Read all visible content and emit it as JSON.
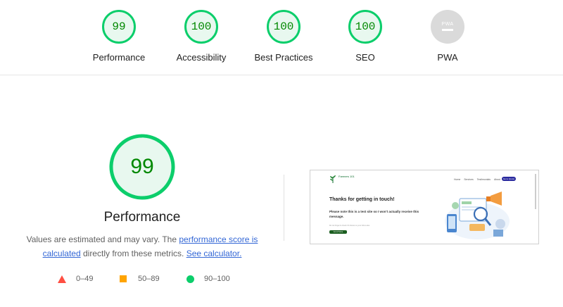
{
  "categories": [
    {
      "label": "Performance",
      "score": "99"
    },
    {
      "label": "Accessibility",
      "score": "100"
    },
    {
      "label": "Best Practices",
      "score": "100"
    },
    {
      "label": "SEO",
      "score": "100"
    },
    {
      "label": "PWA",
      "score": "PWA"
    }
  ],
  "main": {
    "score": "99",
    "score_fraction": 0.99,
    "title": "Performance",
    "desc_prefix": "Values are estimated and may vary. The ",
    "link_score": "performance score is calculated",
    "desc_mid": " directly from these metrics. ",
    "link_calc": "See calculator."
  },
  "legend": {
    "fail": "0–49",
    "average": "50–89",
    "pass": "90–100"
  },
  "thumbnail": {
    "brand": "Farmers 101",
    "nav": [
      "Home",
      "Services",
      "Testimonials",
      "About",
      "Contact"
    ],
    "cta": "Get a Quote",
    "heading": "Thanks for getting in touch!",
    "body": "Please note this is a test site so I won't actually receive this message.",
    "small": "Do not forget to check if it shows on your inbox also.",
    "button": "Go to Home"
  },
  "colors": {
    "pass": "#0cce6b",
    "pass_text": "#008800",
    "average": "#ffa400",
    "fail": "#ff4e42",
    "pwa": "#dadada"
  }
}
